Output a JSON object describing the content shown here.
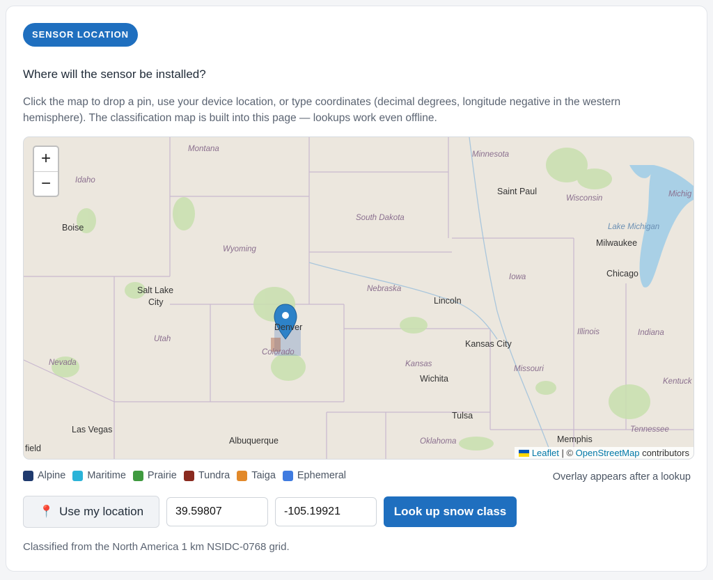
{
  "section_badge": "SENSOR LOCATION",
  "question": "Where will the sensor be installed?",
  "description": "Click the map to drop a pin, use your device location, or type coordinates (decimal degrees, longitude negative in the western hemisphere). The classification map is built into this page — lookups work even offline.",
  "map": {
    "zoom_in": "+",
    "zoom_out": "−",
    "cities": {
      "boise": "Boise",
      "salt_lake_1": "Salt Lake",
      "salt_lake_2": "City",
      "las_vegas": "Las Vegas",
      "albuquerque": "Albuquerque",
      "denver": "Denver",
      "lincoln": "Lincoln",
      "kansas_city": "Kansas City",
      "wichita": "Wichita",
      "tulsa": "Tulsa",
      "saint_paul": "Saint Paul",
      "milwaukee": "Milwaukee",
      "chicago": "Chicago",
      "memphis": "Memphis",
      "field": "field"
    },
    "states": {
      "montana": "Montana",
      "idaho": "Idaho",
      "wyoming": "Wyoming",
      "utah": "Utah",
      "nevada": "Nevada",
      "colorado": "Colorado",
      "south_dakota": "South Dakota",
      "nebraska": "Nebraska",
      "kansas": "Kansas",
      "oklahoma": "Oklahoma",
      "minnesota": "Minnesota",
      "wisconsin": "Wisconsin",
      "michigan": "Michig",
      "lake_michigan": "Lake Michigan",
      "iowa": "Iowa",
      "illinois": "Illinois",
      "indiana": "Indiana",
      "missouri": "Missouri",
      "kentucky": "Kentuck",
      "tennessee": "Tennessee"
    },
    "attribution": {
      "leaflet": "Leaflet",
      "separator": " | © ",
      "osm": "OpenStreetMap",
      "suffix": " contributors"
    }
  },
  "legend": [
    {
      "label": "Alpine",
      "color": "#1f3a6e"
    },
    {
      "label": "Maritime",
      "color": "#2bb3d8"
    },
    {
      "label": "Prairie",
      "color": "#3f9a3f"
    },
    {
      "label": "Tundra",
      "color": "#8a2a1f"
    },
    {
      "label": "Taiga",
      "color": "#e2892a"
    },
    {
      "label": "Ephemeral",
      "color": "#3f7be0"
    }
  ],
  "overlay_note": "Overlay appears after a lookup",
  "use_location_label": "Use my location",
  "latitude_value": "39.59807",
  "longitude_value": "-105.19921",
  "lookup_label": "Look up snow class",
  "footnote": "Classified from the North America 1 km NSIDC-0768 grid.",
  "colors": {
    "accent": "#1f6fbf"
  }
}
